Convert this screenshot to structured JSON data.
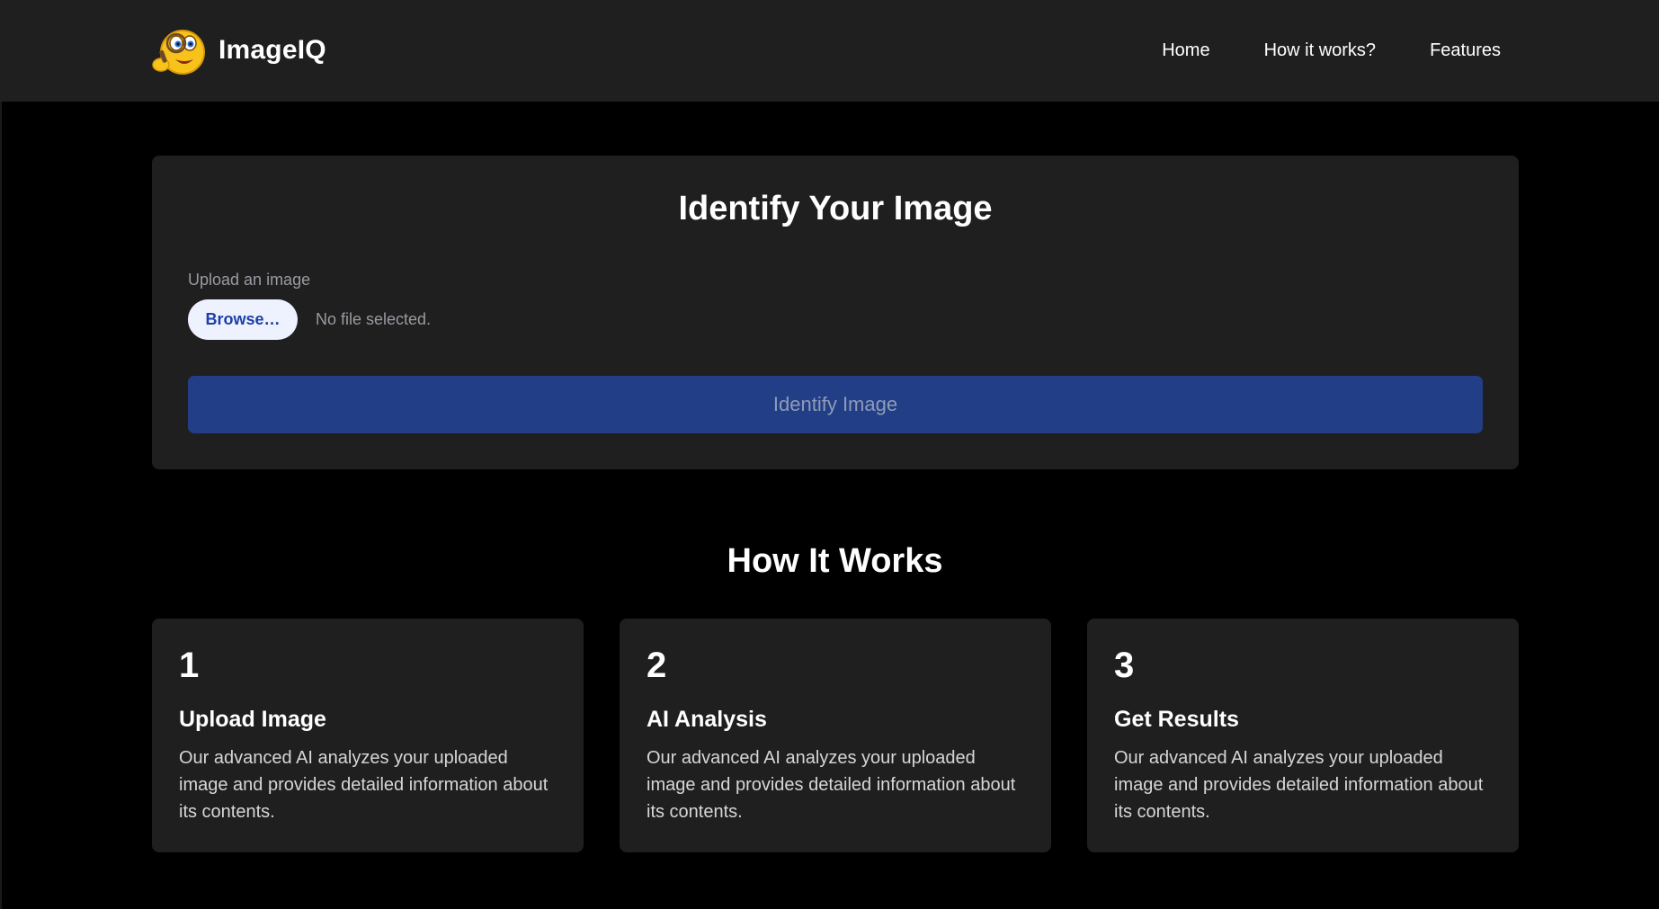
{
  "header": {
    "brand_name": "ImageIQ",
    "logo_icon": "thinking-emoji-magnifier-icon",
    "nav": [
      {
        "label": "Home"
      },
      {
        "label": "How it works?"
      },
      {
        "label": "Features"
      }
    ]
  },
  "identify_card": {
    "title": "Identify Your Image",
    "upload_label": "Upload an image",
    "browse_label": "Browse…",
    "file_status": "No file selected.",
    "identify_button": "Identify Image"
  },
  "how_it_works": {
    "title": "How It Works",
    "steps": [
      {
        "number": "1",
        "title": "Upload Image",
        "description": "Our advanced AI analyzes your uploaded image and provides detailed information about its contents."
      },
      {
        "number": "2",
        "title": "AI Analysis",
        "description": "Our advanced AI analyzes your uploaded image and provides detailed information about its contents."
      },
      {
        "number": "3",
        "title": "Get Results",
        "description": "Our advanced AI analyzes your uploaded image and provides detailed information about its contents."
      }
    ]
  },
  "colors": {
    "background": "#000000",
    "surface": "#1f1f1f",
    "primary_button": "#213e86",
    "browse_button_bg": "#eef2ff",
    "browse_button_text": "#1d3fa8",
    "muted_text": "#9a9aa2"
  }
}
